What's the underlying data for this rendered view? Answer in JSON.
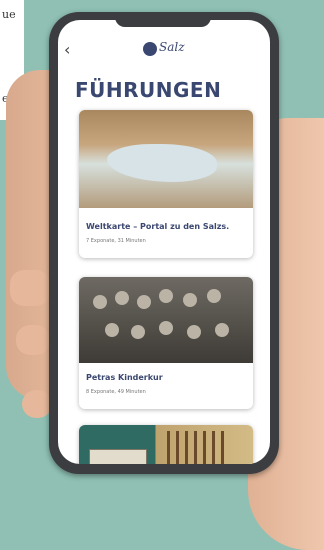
{
  "page_text": {
    "fragments": [
      "ue",
      "e"
    ]
  },
  "app": {
    "logo_text": "Salz",
    "title": "FÜHRUNGEN"
  },
  "cards": [
    {
      "name": "Weltkarte – Portal zu den Salzs.",
      "meta": "7 Exponate, 31 Minuten"
    },
    {
      "name": "Petras Kinderkur",
      "meta": "8 Exponate, 49 Minuten"
    },
    {
      "name": "",
      "meta": ""
    }
  ],
  "colors": {
    "accent": "#3a4770",
    "background": "#8fc0b3"
  }
}
